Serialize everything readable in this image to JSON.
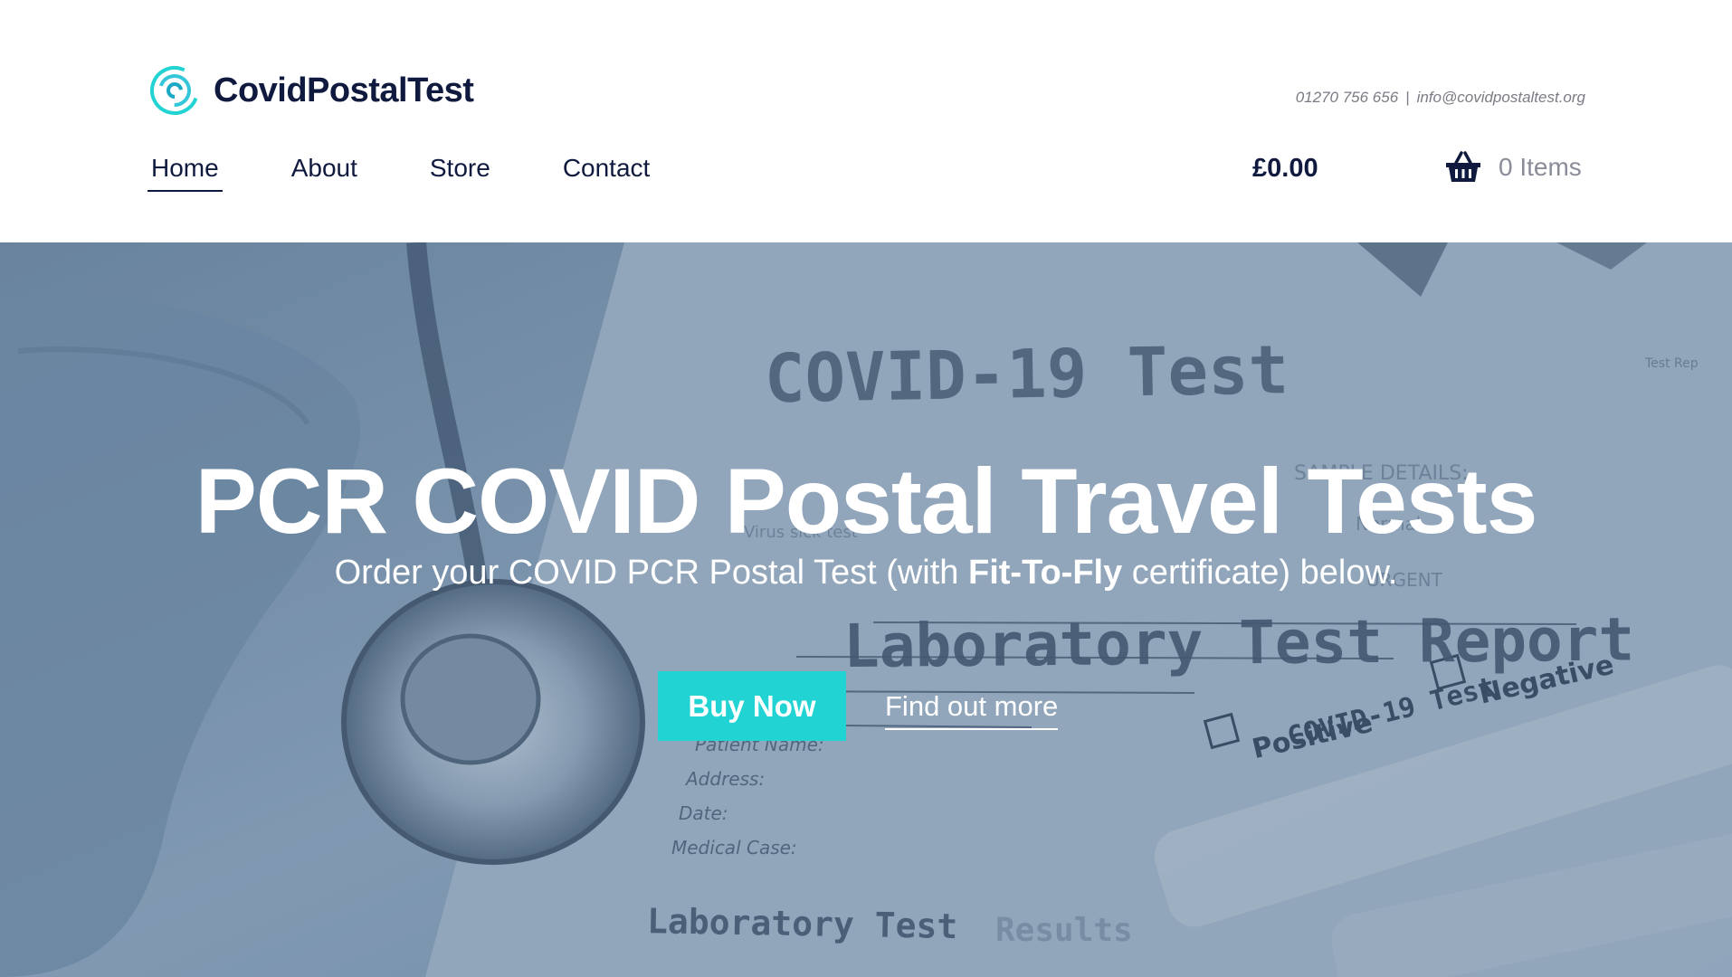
{
  "brand": {
    "name": "CovidPostalTest",
    "logo_icon": "concentric-circle-logo-icon",
    "accent_color": "#22d3d3",
    "navy_color": "#0f1a3e"
  },
  "contact": {
    "phone": "01270 756 656",
    "separator": "|",
    "email": "info@covidpostaltest.org"
  },
  "nav": {
    "items": [
      {
        "label": "Home",
        "active": true
      },
      {
        "label": "About",
        "active": false
      },
      {
        "label": "Store",
        "active": false
      },
      {
        "label": "Contact",
        "active": false
      }
    ]
  },
  "cart": {
    "total": "£0.00",
    "icon": "basket-icon",
    "items_label": "0 Items"
  },
  "hero": {
    "title": "PCR COVID Postal Travel Tests",
    "subtitle_prefix": "Order your COVID PCR Postal Test (with ",
    "subtitle_bold": "Fit-To-Fly",
    "subtitle_suffix": " certificate) below.",
    "buy_label": "Buy Now",
    "more_label": "Find out more",
    "background_texts": {
      "doc_heading": "COVID-19  Test",
      "sample_details": "SAMPLE DETAILS:",
      "virus_sick_test": "Virus sick test",
      "normal": "Normal",
      "urgent": "URGENT",
      "report_heading": "Laboratory Test Report",
      "test_report_corner": "Test Rep",
      "patient_name": "Patient Name:",
      "address": "Address:",
      "date": "Date:",
      "medical_case": "Medical Case:",
      "results_heading_a": "Laboratory Test",
      "results_heading_b": "Results",
      "tube_label": "COVID-19  Test",
      "positive": "Positive",
      "negative": "Negative"
    }
  }
}
